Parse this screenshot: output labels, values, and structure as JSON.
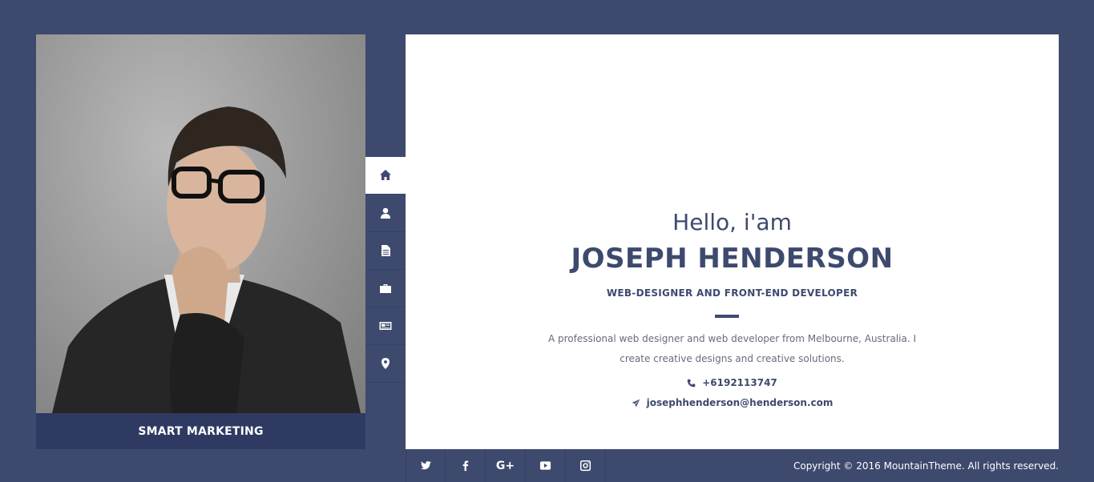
{
  "profile": {
    "caption": "SMART MARKETING",
    "photo_icon": "portrait-photo"
  },
  "nav": {
    "items": [
      {
        "icon": "home-icon",
        "active": true
      },
      {
        "icon": "user-icon",
        "active": false
      },
      {
        "icon": "document-icon",
        "active": false
      },
      {
        "icon": "briefcase-icon",
        "active": false
      },
      {
        "icon": "newspaper-icon",
        "active": false
      },
      {
        "icon": "map-marker-icon",
        "active": false
      }
    ]
  },
  "hero": {
    "greeting": "Hello, i'am",
    "name": "JOSEPH HENDERSON",
    "role": "WEB-DESIGNER AND FRONT-END DEVELOPER",
    "bio": "A professional web designer and web developer from Melbourne, Australia. I create creative designs and creative solutions.",
    "phone": "+6192113747",
    "email": "josephhenderson@henderson.com"
  },
  "footer": {
    "social": [
      "twitter-icon",
      "facebook-icon",
      "google-plus-icon",
      "youtube-icon",
      "instagram-icon"
    ],
    "google_plus_label": "G+",
    "copyright": "Copyright © 2016 MountainTheme. All rights reserved."
  },
  "colors": {
    "background": "#3d4a6e",
    "accent": "#3d4a6e",
    "caption_bg": "#2e3a62",
    "panel": "#ffffff"
  }
}
